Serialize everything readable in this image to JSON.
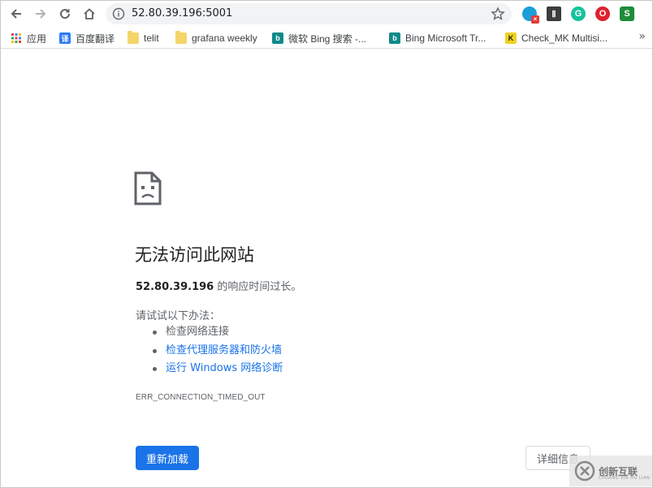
{
  "toolbar": {
    "url": "52.80.39.196:5001"
  },
  "bookmarks": [
    {
      "label": "应用",
      "icon": "apps-grid-icon"
    },
    {
      "label": "百度翻译",
      "icon": "baidu-translate-icon",
      "glyph": "译",
      "color": "#2e7bf6"
    },
    {
      "label": "telit",
      "icon": "folder-icon"
    },
    {
      "label": "grafana weekly",
      "icon": "folder-icon"
    },
    {
      "label": "微软 Bing 搜索 -...",
      "icon": "bing-icon",
      "glyph": "b",
      "color": "#0e8a8a"
    },
    {
      "label": "Bing Microsoft Tr...",
      "icon": "bing-icon",
      "glyph": "b",
      "color": "#0e8a8a"
    },
    {
      "label": "Check_MK Multisi...",
      "icon": "checkmk-icon",
      "glyph": "K",
      "color": "#f0d020"
    }
  ],
  "error": {
    "title": "无法访问此网站",
    "host": "52.80.39.196",
    "desc_suffix": " 的响应时间过长。",
    "suggest_heading": "请试试以下办法：",
    "suggestions": [
      {
        "text": "检查网络连接",
        "link": false
      },
      {
        "text": "检查代理服务器和防火墙",
        "link": true
      },
      {
        "text": "运行 Windows 网络诊断",
        "link": true
      }
    ],
    "code": "ERR_CONNECTION_TIMED_OUT",
    "reload_label": "重新加载",
    "details_label": "详细信息"
  },
  "watermark": {
    "text": "创新互联",
    "sub": "CHUANG XIN HU LIAN"
  },
  "colors": {
    "accent": "#1a73e8",
    "muted": "#5f6368"
  }
}
